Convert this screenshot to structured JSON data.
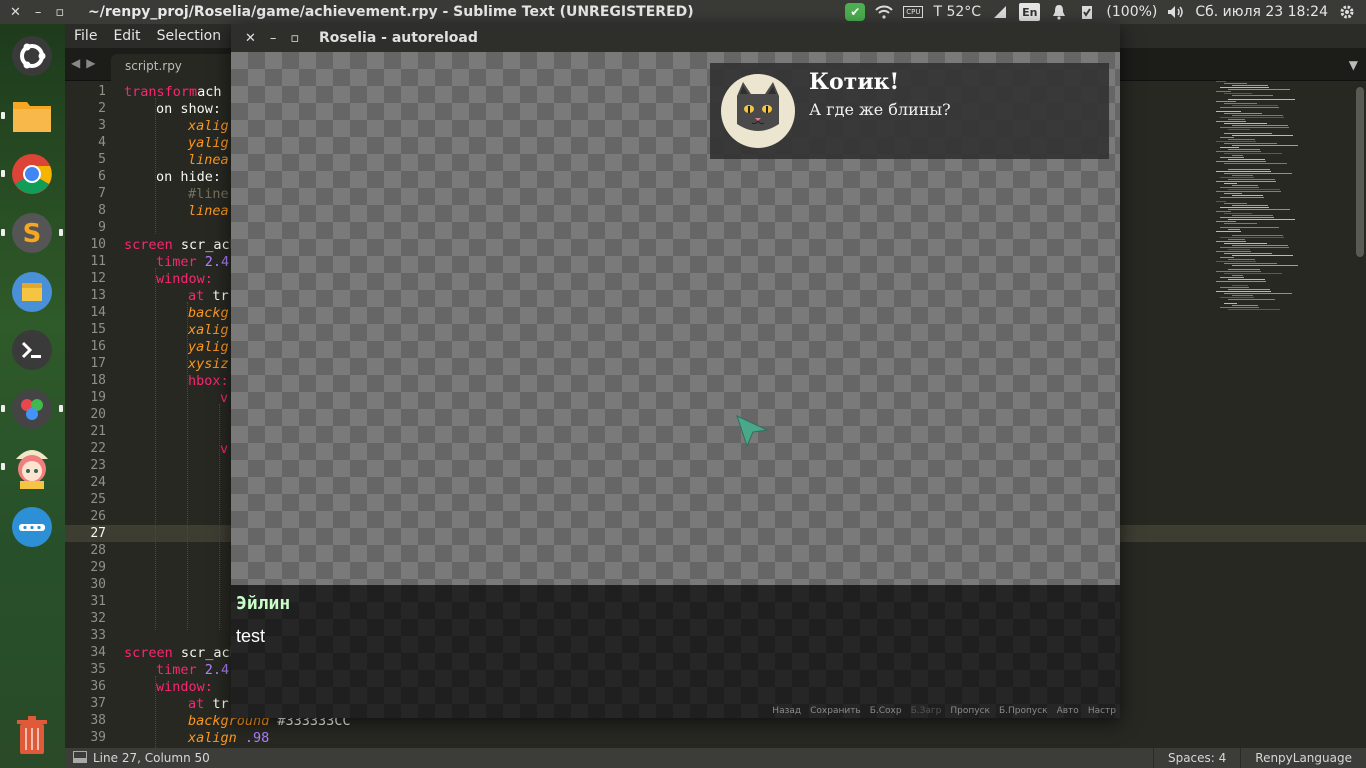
{
  "topbar": {
    "window_controls": [
      "✕",
      "–",
      "▫"
    ],
    "title": "~/renpy_proj/Roselia/game/achievement.rpy - Sublime Text (UNREGISTERED)",
    "temperature": "T 52°C",
    "keyboard_layout": "En",
    "battery": "(100%)",
    "datetime": "Сб. июля 23 18:24",
    "cpu_label": "CPU"
  },
  "launcher": {
    "items": [
      {
        "name": "ubuntu-logo-icon",
        "color": "#3c3c3c"
      },
      {
        "name": "files-icon",
        "color": "#f0a030"
      },
      {
        "name": "chrome-icon",
        "color": "#db4437"
      },
      {
        "name": "sublime-text-icon",
        "color": "#f07d1a"
      },
      {
        "name": "archive-manager-icon",
        "color": "#4a90d9"
      },
      {
        "name": "terminal-icon",
        "color": "#333333"
      },
      {
        "name": "renpy-launcher-icon",
        "color": "#444444"
      },
      {
        "name": "anime-character-icon",
        "color": "#e89090"
      },
      {
        "name": "more-apps-icon",
        "color": "#2d8fd5"
      },
      {
        "name": "trash-icon",
        "color": "#e05a3a"
      }
    ]
  },
  "menubar": {
    "items": [
      "File",
      "Edit",
      "Selection"
    ]
  },
  "tabbar": {
    "arrows": "◀▶",
    "tab_label": "script.rpy",
    "menu_arrow": "▼"
  },
  "editor": {
    "current_line": 27,
    "line_numbers": [
      "1",
      "2",
      "3",
      "4",
      "5",
      "6",
      "7",
      "8",
      "9",
      "10",
      "11",
      "12",
      "13",
      "14",
      "15",
      "16",
      "17",
      "18",
      "19",
      "20",
      "21",
      "22",
      "23",
      "24",
      "25",
      "26",
      "27",
      "28",
      "29",
      "30",
      "31",
      "32",
      "33",
      "34",
      "35",
      "36",
      "37",
      "38",
      "39"
    ],
    "lines": [
      {
        "n": 1,
        "indent": 0,
        "parts": [
          [
            "kw",
            "transform"
          ],
          [
            "",
            "ach"
          ]
        ]
      },
      {
        "n": 2,
        "indent": 1,
        "parts": [
          [
            "",
            "on show:"
          ]
        ]
      },
      {
        "n": 3,
        "indent": 2,
        "parts": [
          [
            "it",
            "xalig"
          ]
        ]
      },
      {
        "n": 4,
        "indent": 2,
        "parts": [
          [
            "it",
            "yalig"
          ]
        ]
      },
      {
        "n": 5,
        "indent": 2,
        "parts": [
          [
            "it",
            "linea"
          ]
        ]
      },
      {
        "n": 6,
        "indent": 1,
        "parts": [
          [
            "",
            "on hide:"
          ]
        ]
      },
      {
        "n": 7,
        "indent": 2,
        "parts": [
          [
            "cm",
            "#line"
          ]
        ]
      },
      {
        "n": 8,
        "indent": 2,
        "parts": [
          [
            "it",
            "linea"
          ]
        ]
      },
      {
        "n": 10,
        "indent": 0,
        "parts": [
          [
            "kw",
            "screen"
          ],
          [
            "",
            " scr_ach"
          ]
        ]
      },
      {
        "n": 11,
        "indent": 1,
        "parts": [
          [
            "kw",
            "timer"
          ],
          [
            "num",
            " 2.4"
          ]
        ]
      },
      {
        "n": 12,
        "indent": 1,
        "parts": [
          [
            "kw",
            "window:"
          ]
        ]
      },
      {
        "n": 13,
        "indent": 2,
        "parts": [
          [
            "kw",
            "at"
          ],
          [
            "",
            " tr"
          ]
        ]
      },
      {
        "n": 14,
        "indent": 2,
        "parts": [
          [
            "it",
            "backg"
          ]
        ]
      },
      {
        "n": 15,
        "indent": 2,
        "parts": [
          [
            "it",
            "xalig"
          ]
        ]
      },
      {
        "n": 16,
        "indent": 2,
        "parts": [
          [
            "it",
            "yalig"
          ]
        ]
      },
      {
        "n": 17,
        "indent": 2,
        "parts": [
          [
            "it",
            "xysiz"
          ]
        ]
      },
      {
        "n": 18,
        "indent": 2,
        "parts": [
          [
            "kw",
            "hbox:"
          ]
        ]
      },
      {
        "n": 19,
        "indent": 3,
        "parts": [
          [
            "kw",
            "v"
          ]
        ]
      },
      {
        "n": 22,
        "indent": 3,
        "parts": [
          [
            "kw",
            "v"
          ]
        ]
      },
      {
        "n": 34,
        "indent": 0,
        "parts": [
          [
            "kw",
            "screen"
          ],
          [
            "",
            " scr_ach"
          ]
        ]
      },
      {
        "n": 35,
        "indent": 1,
        "parts": [
          [
            "kw",
            "timer"
          ],
          [
            "num",
            " 2.4"
          ]
        ]
      },
      {
        "n": 36,
        "indent": 1,
        "parts": [
          [
            "kw",
            "window:"
          ]
        ]
      },
      {
        "n": 37,
        "indent": 2,
        "parts": [
          [
            "kw",
            "at"
          ],
          [
            "",
            " tr"
          ]
        ]
      },
      {
        "n": 38,
        "indent": 2,
        "parts": [
          [
            "it",
            "background"
          ],
          [
            "",
            " #333333CC"
          ]
        ]
      },
      {
        "n": 39,
        "indent": 2,
        "parts": [
          [
            "it",
            "xalign"
          ],
          [
            "num",
            " .98"
          ]
        ]
      }
    ]
  },
  "statusbar": {
    "position": "Line 27, Column 50",
    "spaces": "Spaces: 4",
    "syntax": "RenpyLanguage"
  },
  "game": {
    "window_controls": [
      "✕",
      "–",
      "▫"
    ],
    "title": "Roselia - autoreload",
    "achievement": {
      "title": "Котик!",
      "text": "А где же блины?"
    },
    "dialog": {
      "speaker": "Эйлин",
      "text": "test"
    },
    "quickmenu": [
      {
        "label": "Назад",
        "enabled": true
      },
      {
        "label": "Сохранить",
        "enabled": true
      },
      {
        "label": "Б.Сохр",
        "enabled": true
      },
      {
        "label": "Б.Загр",
        "enabled": false
      },
      {
        "label": "Пропуск",
        "enabled": true
      },
      {
        "label": "Б.Пропуск",
        "enabled": true
      },
      {
        "label": "Авто",
        "enabled": true
      },
      {
        "label": "Настр",
        "enabled": true
      }
    ]
  }
}
